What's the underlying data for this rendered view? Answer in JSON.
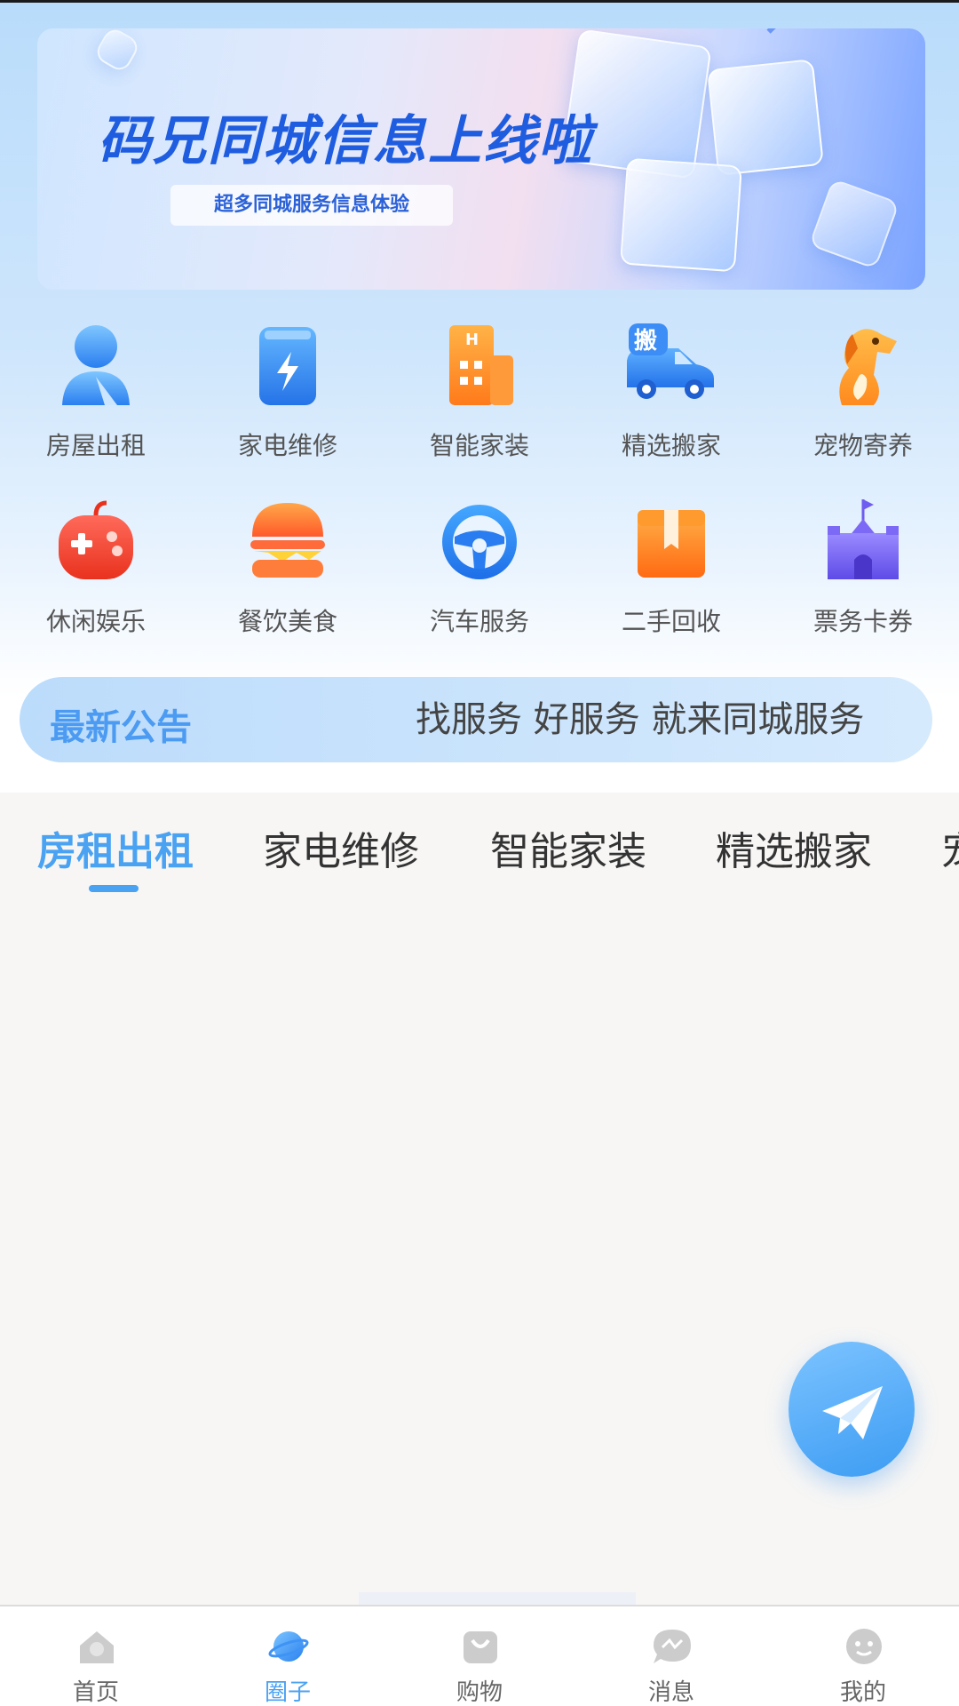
{
  "banner": {
    "title": "码兄同城信息上线啦",
    "subtitle": "超多同城服务信息体验"
  },
  "categories": [
    {
      "label": "房屋出租",
      "icon": "person-icon"
    },
    {
      "label": "家电维修",
      "icon": "battery-icon"
    },
    {
      "label": "智能家装",
      "icon": "building-icon"
    },
    {
      "label": "精选搬家",
      "icon": "moving-truck-icon"
    },
    {
      "label": "宠物寄养",
      "icon": "dog-icon"
    },
    {
      "label": "休闲娱乐",
      "icon": "gamepad-icon"
    },
    {
      "label": "餐饮美食",
      "icon": "burger-icon"
    },
    {
      "label": "汽车服务",
      "icon": "steering-wheel-icon"
    },
    {
      "label": "二手回收",
      "icon": "box-icon"
    },
    {
      "label": "票务卡券",
      "icon": "castle-icon"
    }
  ],
  "moving_badge": "搬",
  "notice": {
    "title": "最新公告",
    "text": "找服务 好服务 就来同城服务"
  },
  "tabs": [
    {
      "label": "房租出租",
      "active": true
    },
    {
      "label": "家电维修",
      "active": false
    },
    {
      "label": "智能家装",
      "active": false
    },
    {
      "label": "精选搬家",
      "active": false
    },
    {
      "label": "宠物寄养",
      "active": false
    }
  ],
  "fab": {
    "icon": "paper-plane-icon"
  },
  "nav": [
    {
      "label": "首页",
      "icon": "home-icon",
      "active": false
    },
    {
      "label": "圈子",
      "icon": "planet-icon",
      "active": true
    },
    {
      "label": "购物",
      "icon": "shopping-bag-icon",
      "active": false
    },
    {
      "label": "消息",
      "icon": "chat-icon",
      "active": false
    },
    {
      "label": "我的",
      "icon": "profile-face-icon",
      "active": false
    }
  ],
  "colors": {
    "accent": "#4aa2f2",
    "banner_title": "#1f5de0",
    "nav_inactive": "#cccccc"
  }
}
